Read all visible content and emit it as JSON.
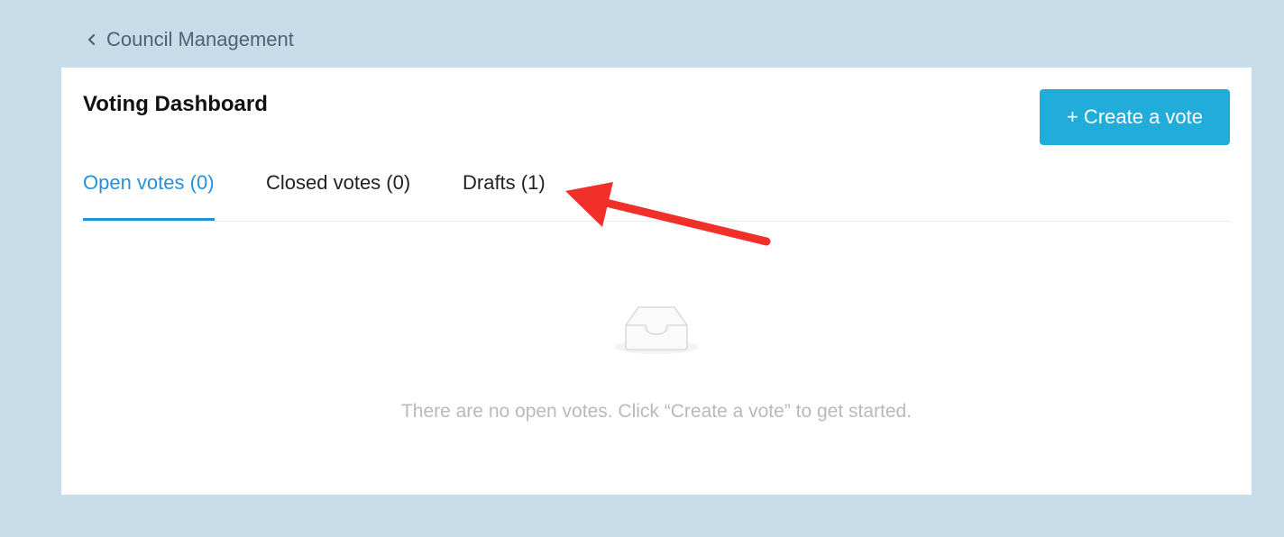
{
  "breadcrumb": {
    "label": "Council Management",
    "icon": "chevron-left-icon"
  },
  "page": {
    "title": "Voting Dashboard"
  },
  "actions": {
    "create_vote_label": "+ Create a vote",
    "create_vote_color": "#21acd9"
  },
  "tabs": [
    {
      "label": "Open votes (0)",
      "active": true
    },
    {
      "label": "Closed votes (0)",
      "active": false
    },
    {
      "label": "Drafts (1)",
      "active": false
    }
  ],
  "empty_state": {
    "icon": "empty-inbox-icon",
    "message": "There are no open votes. Click “Create a vote” to get started."
  },
  "annotation": {
    "icon": "red-arrow-icon",
    "color": "#f2302a"
  },
  "colors": {
    "background": "#c7dbe8",
    "accent": "#2591dc"
  }
}
